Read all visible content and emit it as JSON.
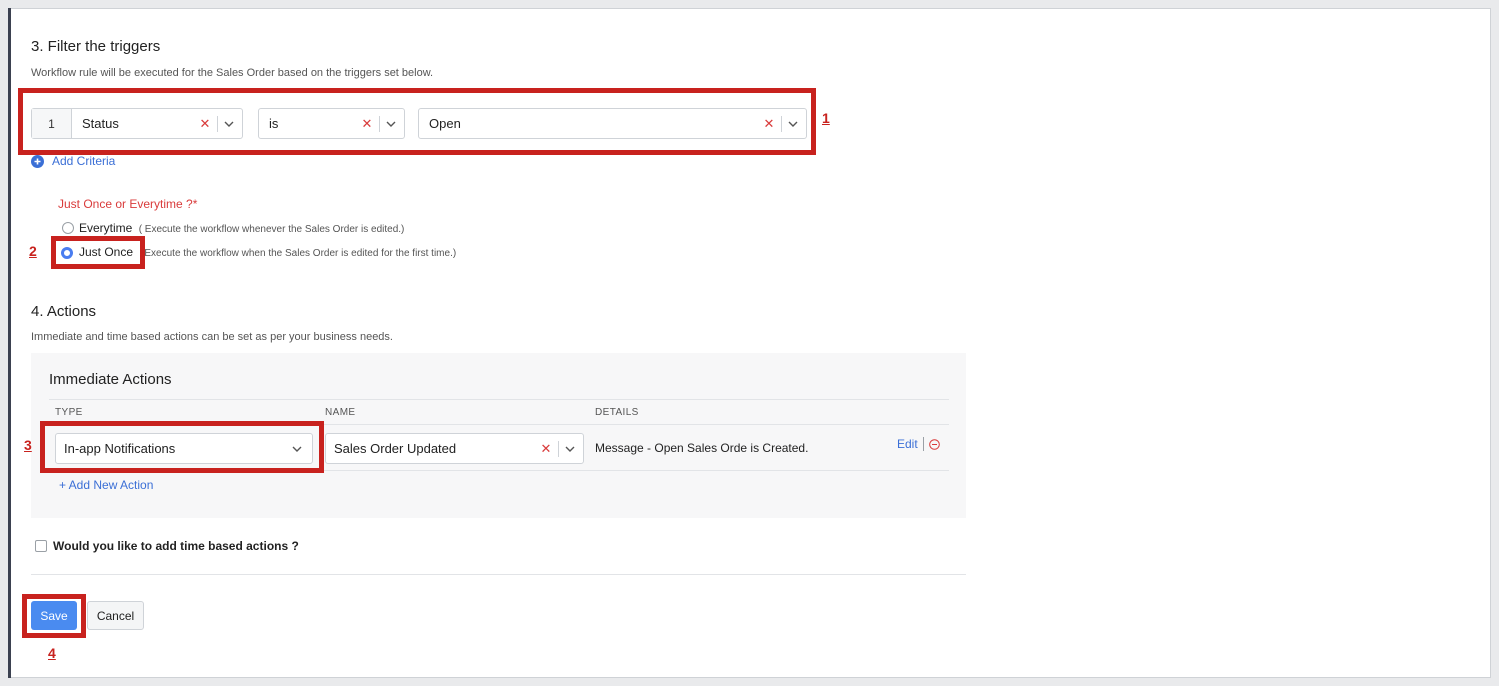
{
  "filter": {
    "title": "3. Filter the triggers",
    "description": "Workflow rule will be executed for the Sales Order based on the triggers set below.",
    "criteria": [
      {
        "index": "1",
        "field": "Status",
        "operator": "is",
        "value": "Open"
      }
    ],
    "add_criteria_label": "Add Criteria"
  },
  "frequency": {
    "question": "Just Once or Everytime ?*",
    "options": [
      {
        "label": "Everytime",
        "hint": "( Execute the workflow whenever the Sales Order is edited.)",
        "selected": false
      },
      {
        "label": "Just Once",
        "hint": "Execute the workflow when the Sales Order is edited for the first time.)",
        "selected": true
      }
    ]
  },
  "actions": {
    "title": "4. Actions",
    "description": "Immediate and time based actions can be set as per your business needs.",
    "immediate_title": "Immediate Actions",
    "columns": [
      "TYPE",
      "NAME",
      "DETAILS"
    ],
    "rows": [
      {
        "type": "In-app Notifications",
        "name": "Sales Order Updated",
        "details": "Message - Open Sales Orde is Created.",
        "edit_label": "Edit"
      }
    ],
    "add_action_label": "+ Add New Action",
    "time_based_label": "Would you like to add time based actions ?"
  },
  "buttons": {
    "save": "Save",
    "cancel": "Cancel"
  },
  "callouts": [
    "1",
    "2",
    "3",
    "4"
  ],
  "colors": {
    "accent": "#4a7df0",
    "annotation": "#c8221e",
    "link": "#3b6fd6",
    "clear": "#d93b3b"
  }
}
